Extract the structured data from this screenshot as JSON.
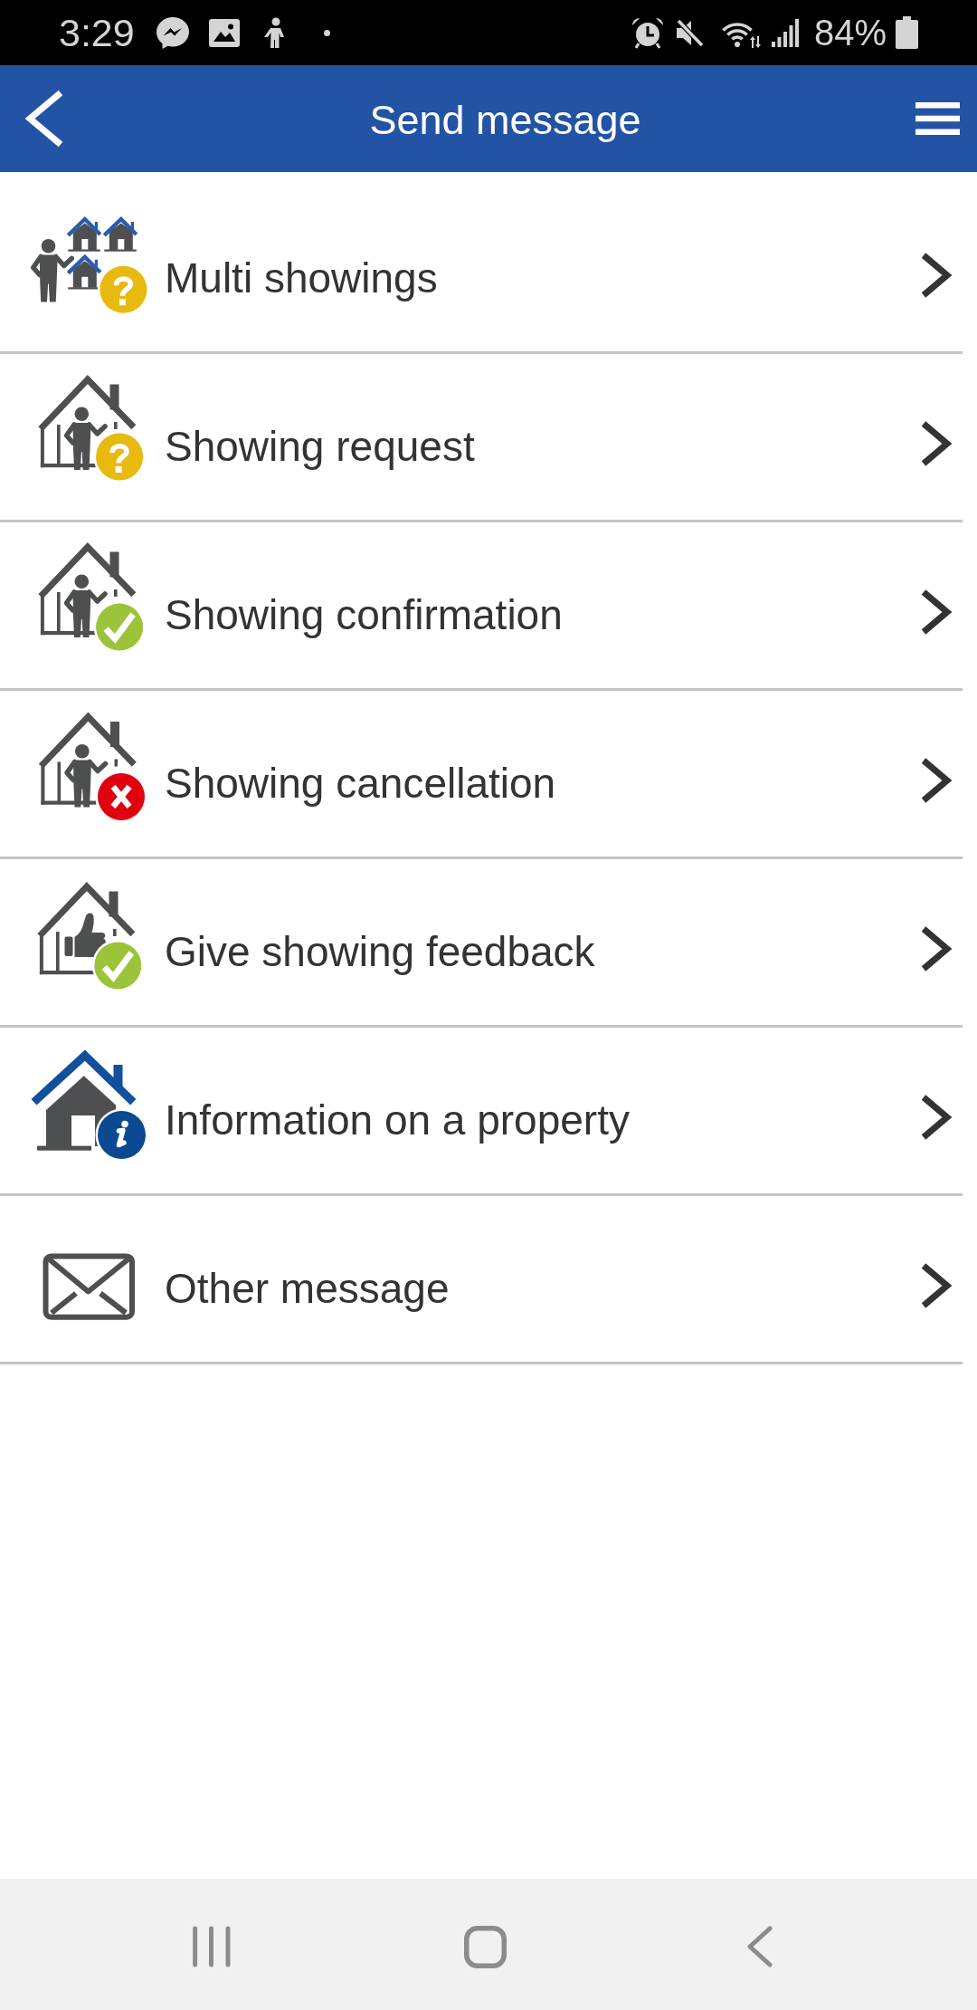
{
  "status_bar": {
    "time": "3:29",
    "battery": "84%"
  },
  "header": {
    "title": "Send message"
  },
  "menu_items": [
    {
      "label": "Multi showings",
      "kind": "multi"
    },
    {
      "label": "Showing request",
      "kind": "request"
    },
    {
      "label": "Showing confirmation",
      "kind": "confirm"
    },
    {
      "label": "Showing cancellation",
      "kind": "cancel"
    },
    {
      "label": "Give showing feedback",
      "kind": "feedback"
    },
    {
      "label": "Information on a property",
      "kind": "info"
    },
    {
      "label": "Other message",
      "kind": "mail"
    }
  ]
}
